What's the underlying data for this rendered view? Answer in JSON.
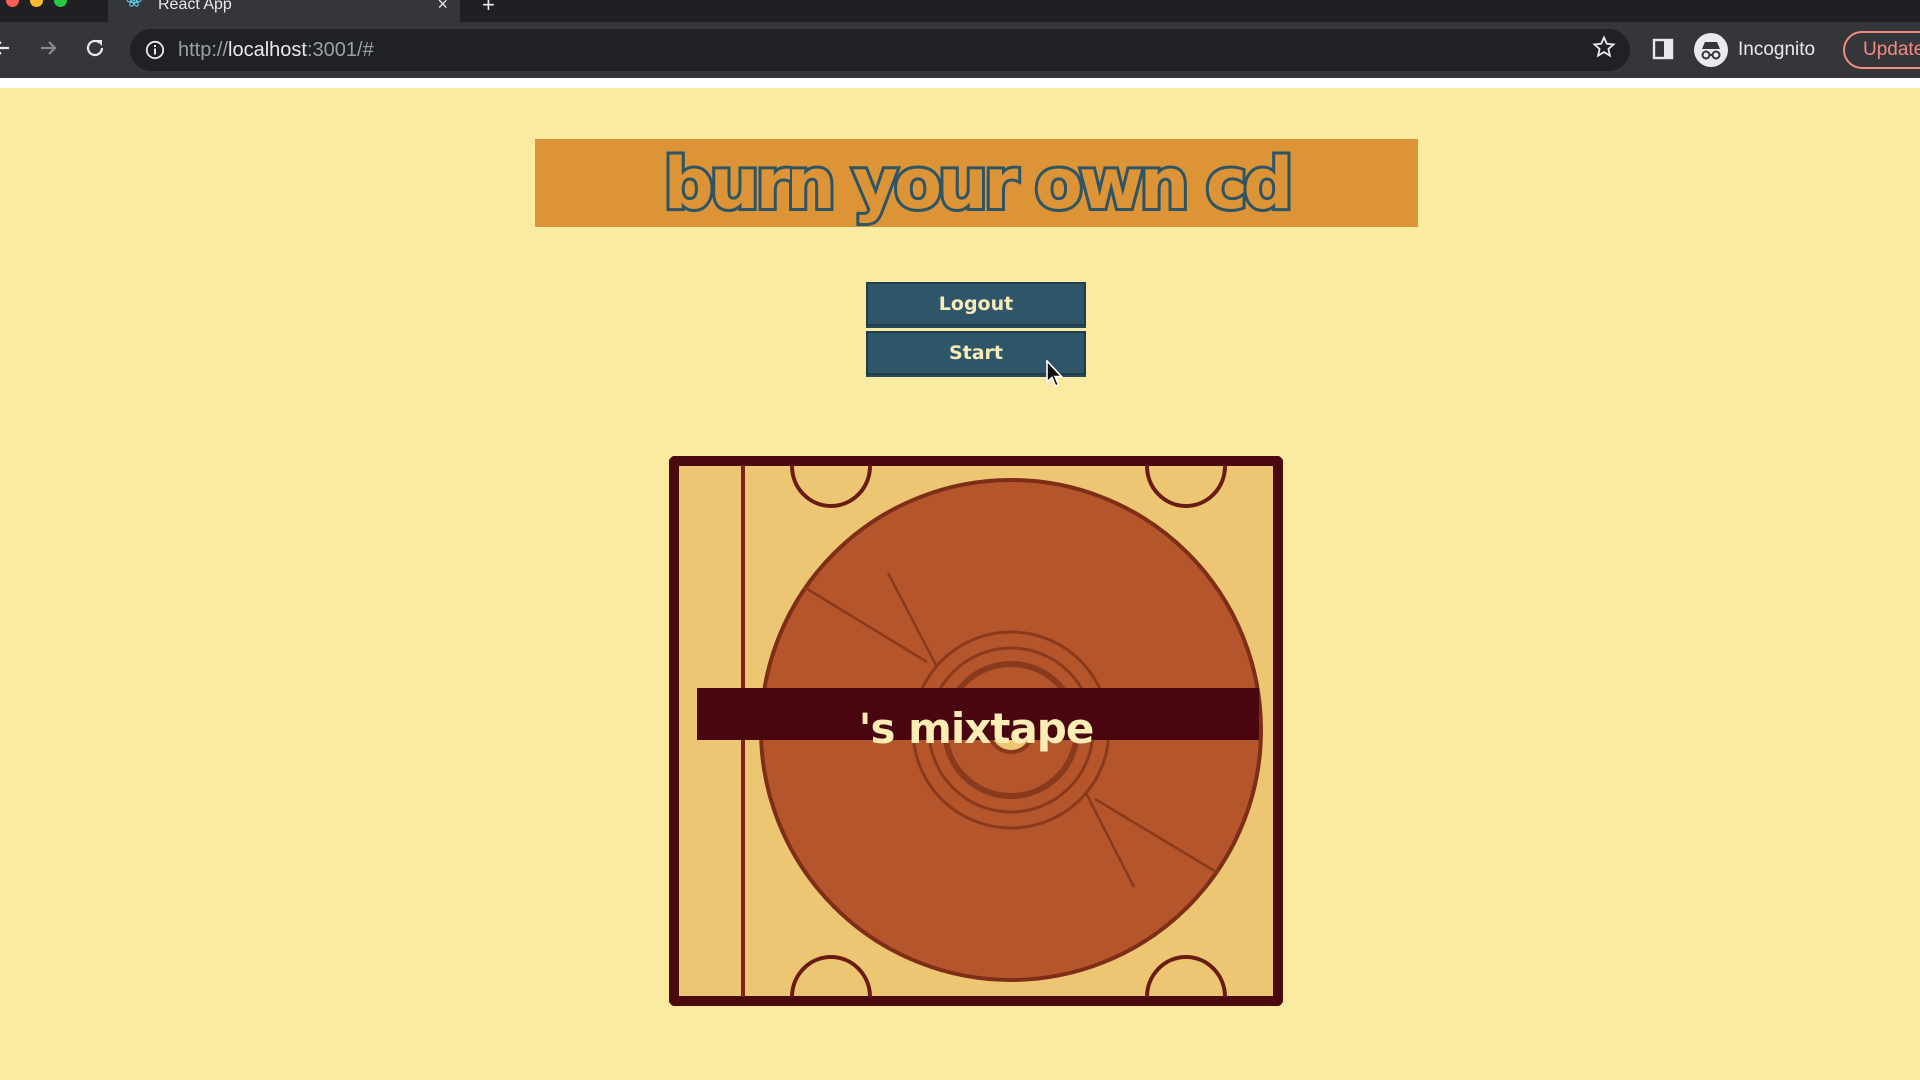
{
  "browser": {
    "tab": {
      "title": "React App",
      "close": "×"
    },
    "new_tab": "+",
    "url": {
      "scheme": "http://",
      "host": "localhost",
      "rest": ":3001/#"
    },
    "profile_label": "Incognito",
    "update_label": "Update"
  },
  "app": {
    "banner_title": "burn your own cd",
    "logout_label": "Logout",
    "start_label": "Start",
    "mixtape_label": "'s mixtape"
  },
  "colors": {
    "page_background": "#faeba1",
    "banner_background": "#dc9436",
    "button_background": "#2f5568",
    "case_border": "#4a0a10",
    "case_fill": "#ecc672",
    "disc": "#b4552c",
    "label_band": "#4a0610"
  }
}
